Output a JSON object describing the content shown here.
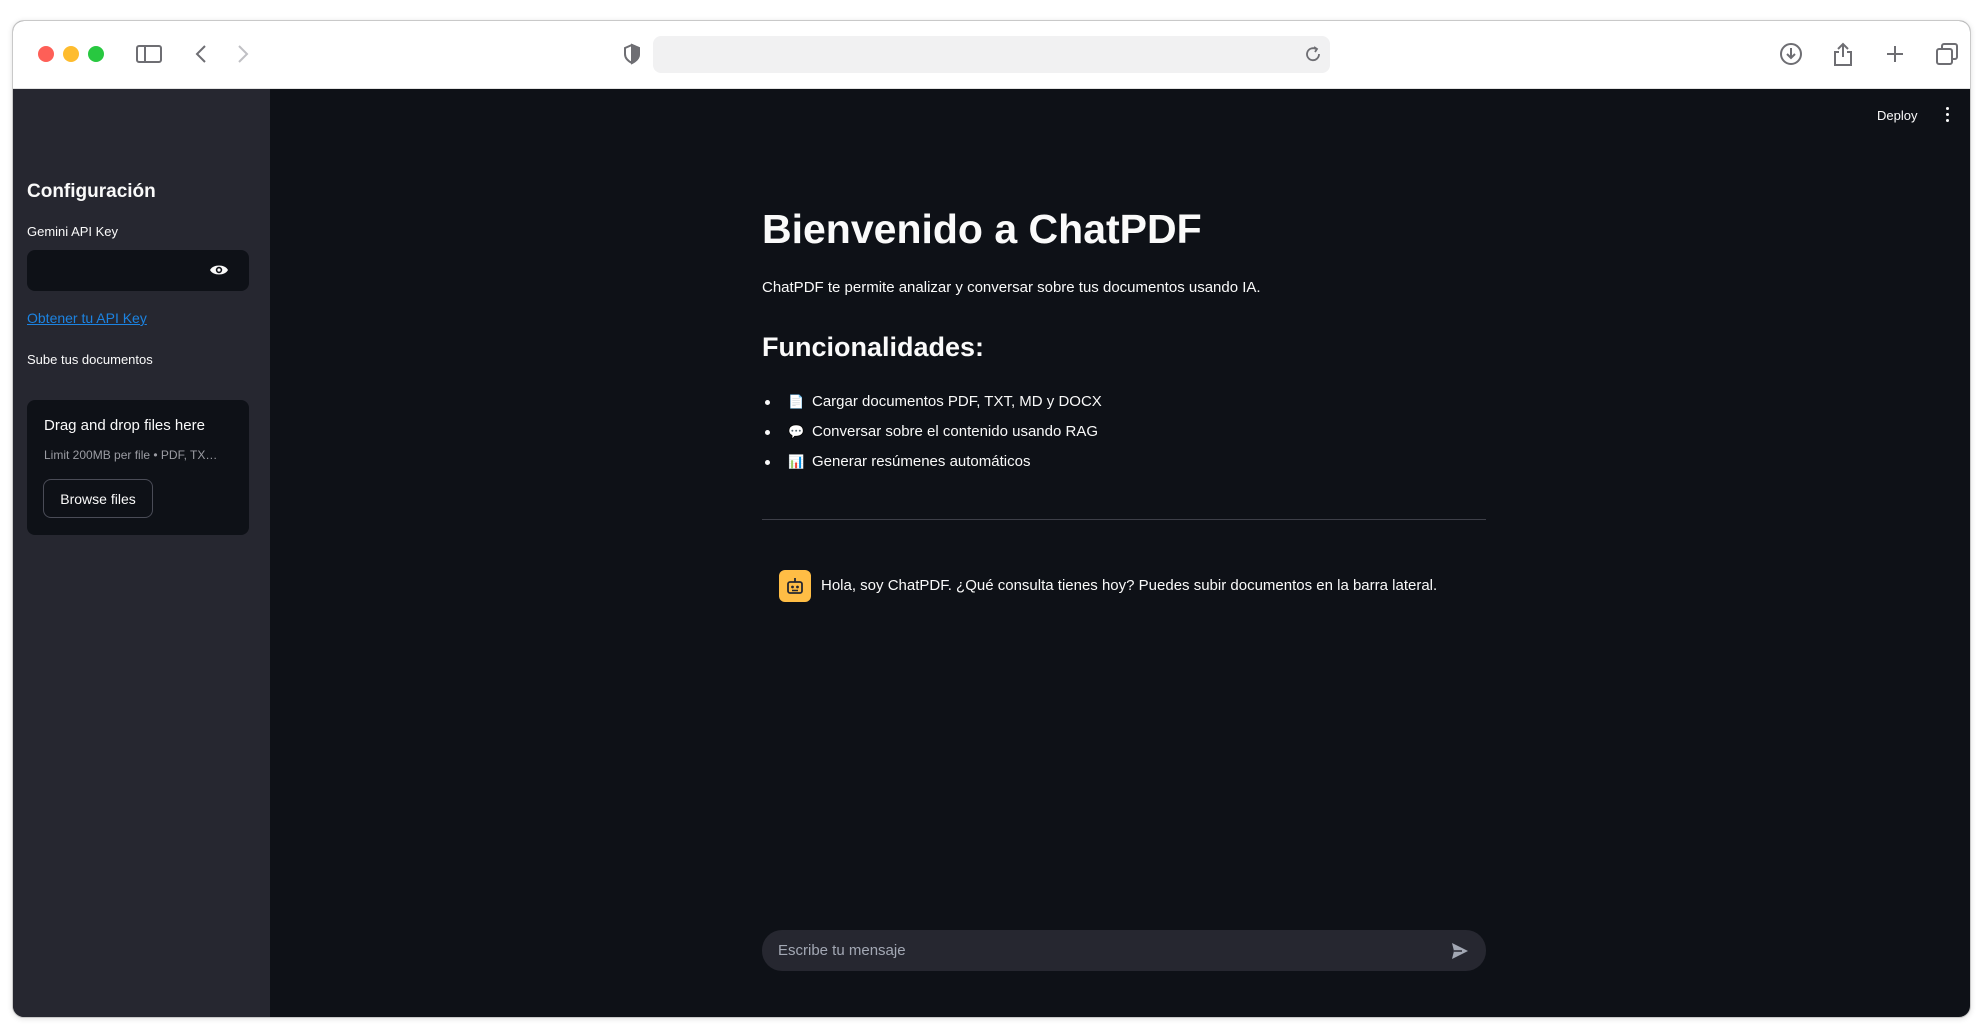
{
  "browser": {
    "url": "",
    "icons": [
      "sidebar-toggle-icon",
      "back-icon",
      "forward-icon",
      "shield-icon",
      "reload-icon",
      "download-icon",
      "share-icon",
      "new-tab-icon",
      "tabs-overview-icon"
    ]
  },
  "sidebar": {
    "title": "Configuración",
    "api_key_label": "Gemini API Key",
    "api_key_value": "",
    "api_link": "Obtener tu API Key",
    "upload_label": "Sube tus documentos",
    "upload_title": "Drag and drop files here",
    "upload_limit": "Limit 200MB per file • PDF, TX…",
    "browse_label": "Browse files"
  },
  "header": {
    "deploy_label": "Deploy"
  },
  "main": {
    "title": "Bienvenido a ChatPDF",
    "intro": "ChatPDF te permite analizar y conversar sobre tus documentos usando IA.",
    "features_heading": "Funcionalidades:",
    "features": [
      {
        "icon": "📄",
        "text": "Cargar documentos PDF, TXT, MD y DOCX"
      },
      {
        "icon": "💬",
        "text": "Conversar sobre el contenido usando RAG"
      },
      {
        "icon": "📊",
        "text": "Generar resúmenes automáticos"
      }
    ],
    "bot_message": "Hola, soy ChatPDF. ¿Qué consulta tienes hoy? Puedes subir documentos en la barra lateral.",
    "chat_placeholder": "Escribe tu mensaje"
  },
  "colors": {
    "background": "#0e1117",
    "sidebar": "#262730",
    "text": "#fafafa",
    "link": "#1c83e1",
    "bot_avatar": "#ffbd45"
  }
}
